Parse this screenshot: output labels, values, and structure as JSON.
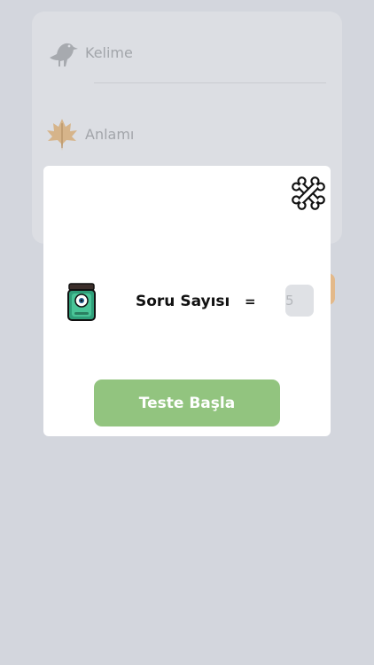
{
  "background_form": {
    "word_label": "Kelime",
    "word_icon": "crow-icon",
    "meaning_label": "Anlamı",
    "meaning_icon": "leaf-icon"
  },
  "modal": {
    "close_icon": "crossed-bones-icon",
    "question_icon": "jar-icon",
    "question_count_label": "Soru Sayısı",
    "equals_sign": "=",
    "question_count_placeholder": "5",
    "start_button_label": "Teste Başla"
  },
  "colors": {
    "overlay_background": "#d3d6dd",
    "modal_background": "#ffffff",
    "start_button": "#92c47f",
    "input_background": "#dfe1e5"
  }
}
